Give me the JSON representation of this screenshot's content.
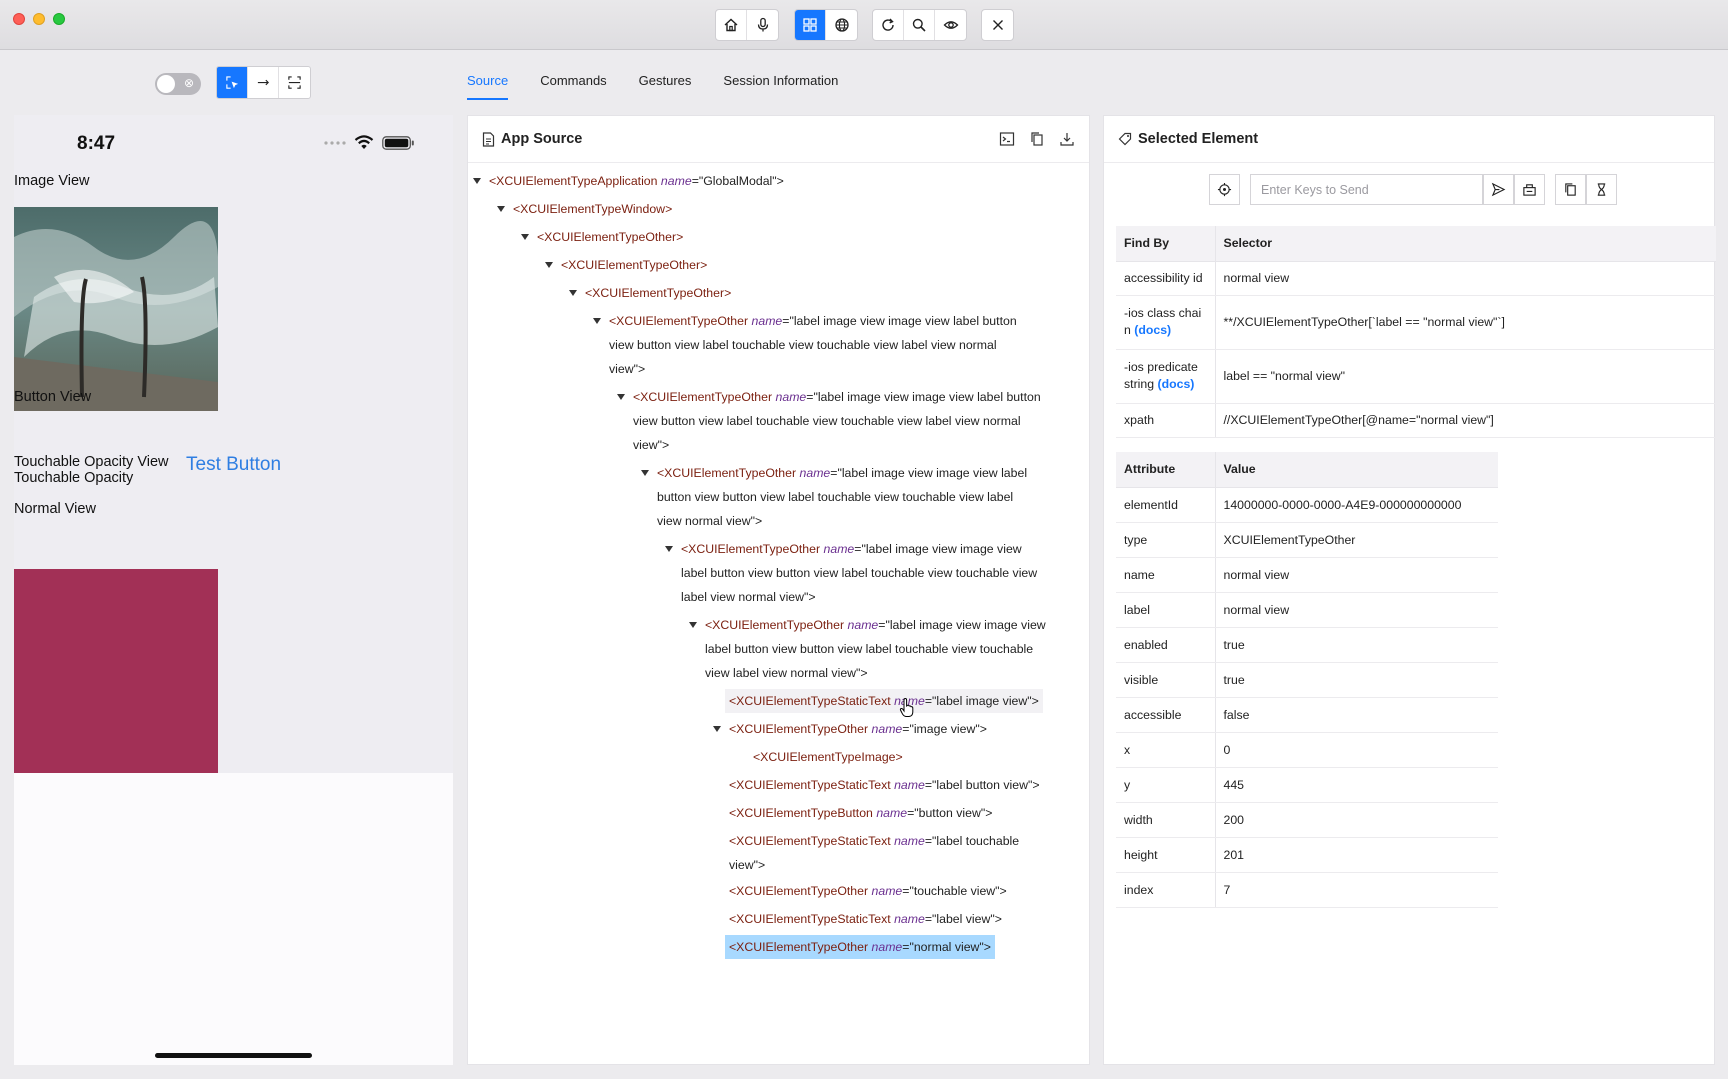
{
  "toolbar": {
    "groups": [
      [
        "home-icon",
        "microphone-icon"
      ],
      [
        "grid-icon",
        "globe-icon"
      ],
      [
        "refresh-icon",
        "search-icon",
        "eye-icon"
      ],
      [
        "close-icon"
      ]
    ]
  },
  "device": {
    "time": "8:47",
    "labels": {
      "image_view": "Image View",
      "button_view": "Button View",
      "test_button": "Test Button",
      "touchable_opacity_view": "Touchable Opacity View",
      "touchable_opacity": "Touchable Opacity",
      "normal_view": "Normal View"
    },
    "normal_view_color": "#a23056",
    "accent_color": "#1677ff"
  },
  "tabs": [
    "Source",
    "Commands",
    "Gestures",
    "Session Information"
  ],
  "source": {
    "title": "App Source",
    "nodes": [
      {
        "tag": "<XCUIElementTypeApplication",
        "attr": "name",
        "val": "=\"GlobalModal\">",
        "lines": null
      },
      {
        "tag": "<XCUIElementTypeWindow>",
        "attr": "",
        "val": "",
        "lines": null
      },
      {
        "tag": "<XCUIElementTypeOther>",
        "attr": "",
        "val": "",
        "lines": null
      },
      {
        "tag": "<XCUIElementTypeOther>",
        "attr": "",
        "val": "",
        "lines": null
      },
      {
        "tag": "<XCUIElementTypeOther>",
        "attr": "",
        "val": "",
        "lines": null
      },
      {
        "tag": "<XCUIElementTypeOther",
        "attr": "name",
        "val": "=\"label image view image view label button",
        "lines": [
          "view button view label touchable view touchable view label view normal",
          "view\">"
        ]
      },
      {
        "tag": "<XCUIElementTypeOther",
        "attr": "name",
        "val": "=\"label image view image view label button",
        "lines": [
          "view button view label touchable view touchable view label view normal",
          "view\">"
        ]
      },
      {
        "tag": "<XCUIElementTypeOther",
        "attr": "name",
        "val": "=\"label image view image view label",
        "lines": [
          "button view button view label touchable view touchable view label",
          "view normal view\">"
        ]
      },
      {
        "tag": "<XCUIElementTypeOther",
        "attr": "name",
        "val": "=\"label image view image view",
        "lines": [
          "label button view button view label touchable view touchable view",
          "label view normal view\">"
        ]
      },
      {
        "tag": "<XCUIElementTypeOther",
        "attr": "name",
        "val": "=\"label image view image view",
        "lines": [
          "label button view button view label touchable view touchable",
          "view label view normal view\">"
        ]
      },
      {
        "tag": "<XCUIElementTypeStaticText",
        "attr": "name",
        "val": "=\"label image view\">",
        "lines": null
      },
      {
        "tag": "<XCUIElementTypeOther",
        "attr": "name",
        "val": "=\"image view\">",
        "lines": null
      },
      {
        "tag": "<XCUIElementTypeImage>",
        "attr": "",
        "val": "",
        "lines": null
      },
      {
        "tag": "<XCUIElementTypeStaticText",
        "attr": "name",
        "val": "=\"label button view\">",
        "lines": null
      },
      {
        "tag": "<XCUIElementTypeButton",
        "attr": "name",
        "val": "=\"button view\">",
        "lines": null
      },
      {
        "tag": "<XCUIElementTypeStaticText",
        "attr": "name",
        "val": "=\"label touchable",
        "lines": [
          "view\">"
        ]
      },
      {
        "tag": "<XCUIElementTypeOther",
        "attr": "name",
        "val": "=\"touchable view\">",
        "lines": null
      },
      {
        "tag": "<XCUIElementTypeStaticText",
        "attr": "name",
        "val": "=\"label view\">",
        "lines": null
      },
      {
        "tag": "<XCUIElementTypeOther",
        "attr": "name",
        "val": "=\"normal view\">",
        "lines": null
      }
    ]
  },
  "selected": {
    "title": "Selected Element",
    "keys_placeholder": "Enter Keys to Send",
    "findby_headers": [
      "Find By",
      "Selector"
    ],
    "findby_rows": [
      {
        "key": [
          "accessibility id"
        ],
        "docs": "",
        "value": "normal view"
      },
      {
        "key": [
          "-ios class chai",
          "n"
        ],
        "docs": "(docs)",
        "value": "**/XCUIElementTypeOther[`label == \"normal view\"`]"
      },
      {
        "key": [
          "-ios predicate",
          "string"
        ],
        "docs": "(docs)",
        "value": "label == \"normal view\""
      },
      {
        "key": [
          "xpath"
        ],
        "docs": "",
        "value": "//XCUIElementTypeOther[@name=\"normal view\"]"
      }
    ],
    "attr_headers": [
      "Attribute",
      "Value"
    ],
    "attr_rows": [
      [
        "elementId",
        "14000000-0000-0000-A4E9-000000000000"
      ],
      [
        "type",
        "XCUIElementTypeOther"
      ],
      [
        "name",
        "normal view"
      ],
      [
        "label",
        "normal view"
      ],
      [
        "enabled",
        "true"
      ],
      [
        "visible",
        "true"
      ],
      [
        "accessible",
        "false"
      ],
      [
        "x",
        "0"
      ],
      [
        "y",
        "445"
      ],
      [
        "width",
        "200"
      ],
      [
        "height",
        "201"
      ],
      [
        "index",
        "7"
      ]
    ]
  }
}
